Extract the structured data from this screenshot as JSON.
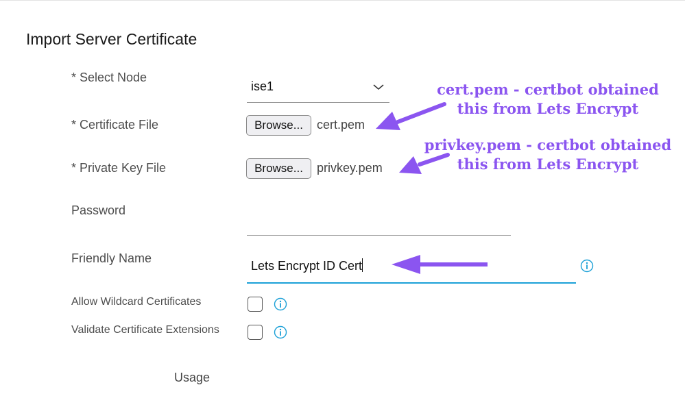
{
  "page": {
    "title": "Import Server Certificate"
  },
  "form": {
    "select_node": {
      "label": "* Select Node",
      "value": "ise1"
    },
    "certificate_file": {
      "label": "* Certificate File",
      "button": "Browse...",
      "file": "cert.pem"
    },
    "private_key_file": {
      "label": "* Private Key File",
      "button": "Browse...",
      "file": "privkey.pem"
    },
    "password": {
      "label": "Password",
      "value": ""
    },
    "friendly_name": {
      "label": "Friendly Name",
      "value": "Lets Encrypt ID Cert"
    },
    "allow_wildcard": {
      "label": "Allow Wildcard Certificates",
      "checked": false
    },
    "validate_extensions": {
      "label": "Validate Certificate Extensions",
      "checked": false
    },
    "usage": {
      "label": "Usage"
    }
  },
  "annotations": {
    "cert": {
      "line1": "cert.pem - certbot obtained",
      "line2": "this from Lets Encrypt"
    },
    "privkey": {
      "line1": "privkey.pem - certbot obtained",
      "line2": "this from Lets Encrypt"
    },
    "color": "#8b55f0"
  },
  "colors": {
    "accent": "#1ba0d7",
    "annotation": "#8b55f0"
  }
}
